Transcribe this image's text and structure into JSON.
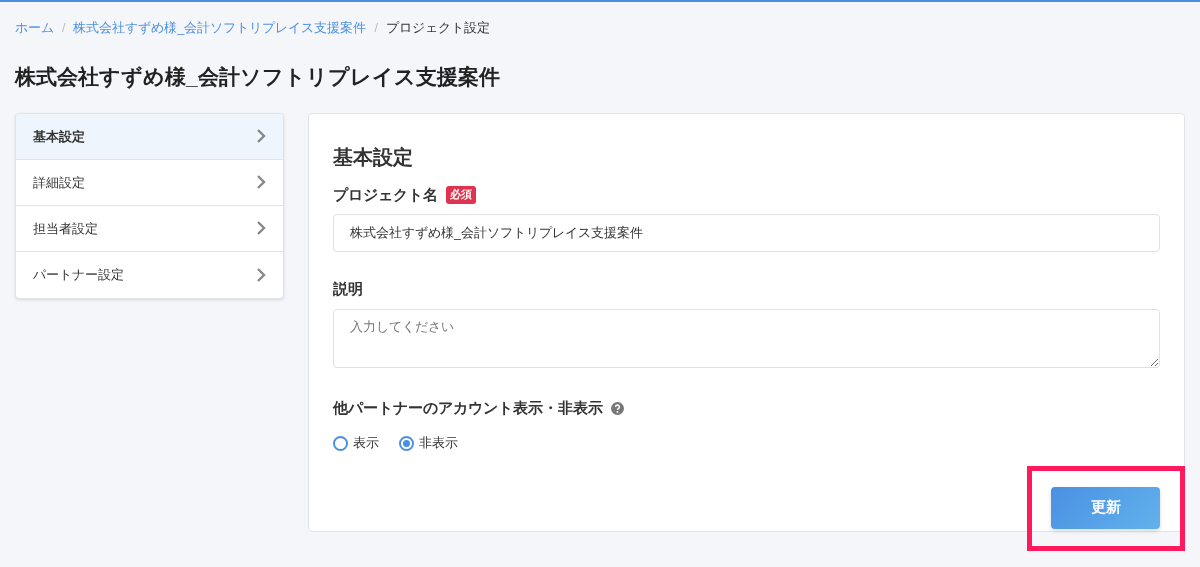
{
  "breadcrumb": [
    {
      "label": "ホーム",
      "link": true
    },
    {
      "separator": "/",
      "label": "株式会社すずめ様_会計ソフトリプレイス支援案件",
      "link": true
    },
    {
      "separator": "/",
      "label": "プロジェクト設定",
      "link": false
    }
  ],
  "page_title": "株式会社すずめ様_会計ソフトリプレイス支援案件",
  "sidebar": {
    "items": [
      {
        "label": "基本設定",
        "selected": true
      },
      {
        "label": "詳細設定",
        "selected": false
      },
      {
        "label": "担当者設定",
        "selected": false
      },
      {
        "label": "パートナー設定",
        "selected": false
      }
    ]
  },
  "form": {
    "heading": "基本設定",
    "project_name": {
      "label": "プロジェクト名",
      "required_badge": "必須",
      "value": "株式会社すずめ様_会計ソフトリプレイス支援案件"
    },
    "description": {
      "label": "説明",
      "placeholder": "入力してください"
    },
    "visibility": {
      "label": "他パートナーのアカウント表示・非表示",
      "options": [
        {
          "label": "表示",
          "selected": false
        },
        {
          "label": "非表示",
          "selected": true
        }
      ]
    },
    "submit": {
      "label": "更新",
      "highlighted": true
    }
  }
}
